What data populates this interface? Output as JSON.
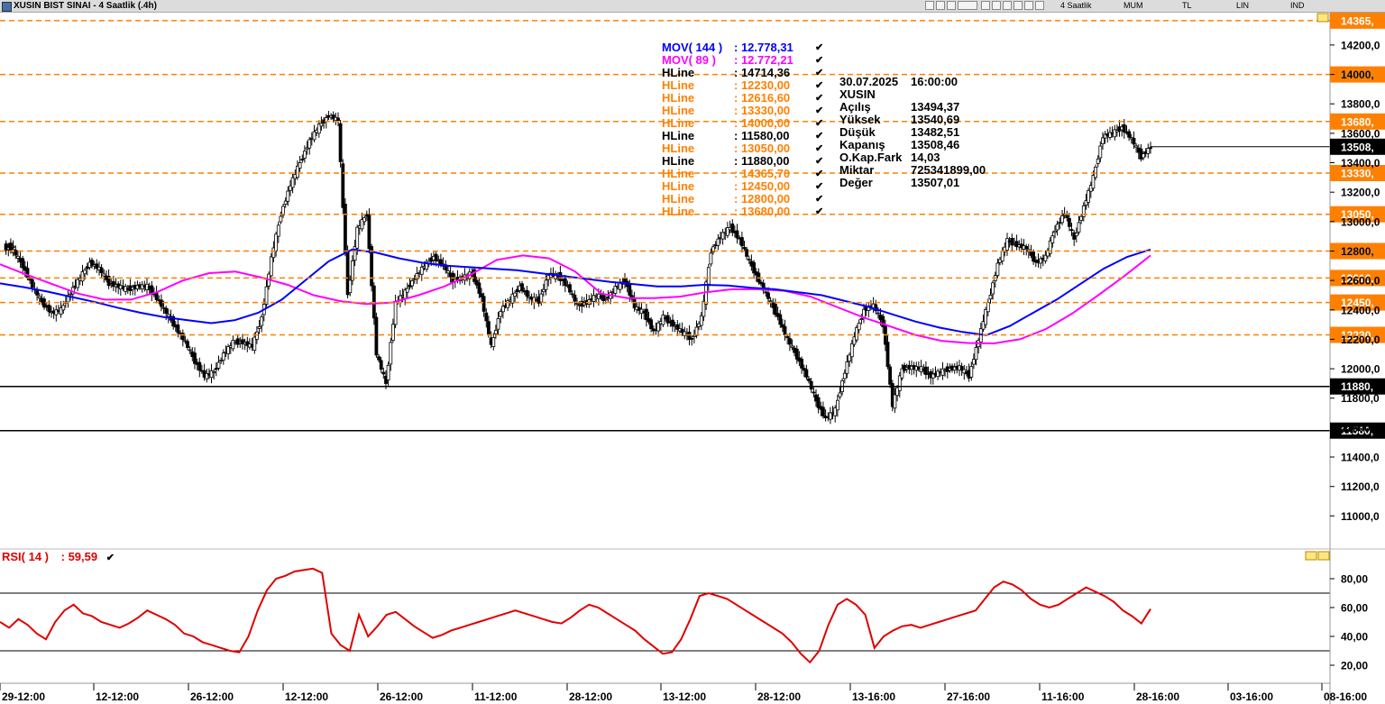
{
  "window": {
    "title": "XUSIN BIST SINAI - 4 Saatlik (.4h)",
    "toolbar": [
      "4 Saatlik",
      "MUM",
      "TL",
      "LIN",
      "IND"
    ]
  },
  "price_axis": {
    "ticks": [
      "14200,0",
      "14000,",
      "13800,0",
      "13600,0",
      "13400,0",
      "13200,0",
      "13000,0",
      "12800,",
      "12600,0",
      "12400,0",
      "12200,0",
      "12000,0",
      "11800,0",
      "11600,0",
      "11400,0",
      "11200,0",
      "11000,0"
    ]
  },
  "rsi_axis": {
    "ticks": [
      "80,00",
      "60,00",
      "40,00",
      "20,00"
    ]
  },
  "time_axis": {
    "labels": [
      "29-12:00",
      "12-12:00",
      "26-12:00",
      "12-12:00",
      "26-12:00",
      "11-12:00",
      "28-12:00",
      "13-12:00",
      "28-12:00",
      "13-16:00",
      "27-16:00",
      "11-16:00",
      "28-16:00",
      "03-16:00",
      "08-16:00"
    ]
  },
  "hlines": [
    {
      "value": 14365.7,
      "tag": "14365,",
      "color": "#ff8000",
      "dash": true
    },
    {
      "value": 14000.0,
      "tag": "14000,",
      "color": "#ff8000",
      "dash": true
    },
    {
      "value": 13680.0,
      "tag": "13680,",
      "color": "#ff8000",
      "dash": true
    },
    {
      "value": 13330.0,
      "tag": "13330,",
      "color": "#ff8000",
      "dash": true
    },
    {
      "value": 13050.0,
      "tag": "13050,",
      "color": "#ff8000",
      "dash": true
    },
    {
      "value": 12800.0,
      "tag": "12800,",
      "color": "#ff8000",
      "dash": true
    },
    {
      "value": 12616.6,
      "tag": "12616,",
      "color": "#ff8000",
      "dash": true
    },
    {
      "value": 12450.0,
      "tag": "12450,",
      "color": "#ff8000",
      "dash": true
    },
    {
      "value": 12230.0,
      "tag": "12230,",
      "color": "#ff8000",
      "dash": true
    },
    {
      "value": 11880.0,
      "tag": "11880,",
      "color": "#000000",
      "dash": false
    },
    {
      "value": 11580.0,
      "tag": "11580,",
      "color": "#000000",
      "dash": false
    }
  ],
  "last_price": {
    "value": 13508.46,
    "tag": "13508,"
  },
  "indicators": [
    {
      "name": "MOV( 144 )",
      "value": ": 12.778,31",
      "color": "#0000ff"
    },
    {
      "name": "MOV( 89 )",
      "value": ": 12.772,21",
      "color": "#ff00ff"
    },
    {
      "name": "HLine",
      "value": ": 14714,36",
      "color": "#000000"
    },
    {
      "name": "HLine",
      "value": ": 12230,00",
      "color": "#ff8000"
    },
    {
      "name": "HLine",
      "value": ": 12616,60",
      "color": "#ff8000"
    },
    {
      "name": "HLine",
      "value": ": 13330,00",
      "color": "#ff8000"
    },
    {
      "name": "HLine",
      "value": ": 14000,00",
      "color": "#ff8000"
    },
    {
      "name": "HLine",
      "value": ": 11580,00",
      "color": "#000000"
    },
    {
      "name": "HLine",
      "value": ": 13050,00",
      "color": "#ff8000"
    },
    {
      "name": "HLine",
      "value": ": 11880,00",
      "color": "#000000"
    },
    {
      "name": "HLine",
      "value": ": 14365,70",
      "color": "#ff8000"
    },
    {
      "name": "HLine",
      "value": ": 12450,00",
      "color": "#ff8000"
    },
    {
      "name": "HLine",
      "value": ": 12800,00",
      "color": "#ff8000"
    },
    {
      "name": "HLine",
      "value": ": 13680,00",
      "color": "#ff8000"
    }
  ],
  "data_box": {
    "date": "30.07.2025",
    "time": "16:00:00",
    "symbol": "XUSIN",
    "rows": [
      {
        "key": "Açılış",
        "value": "13494,37"
      },
      {
        "key": "Yüksek",
        "value": "13540,69"
      },
      {
        "key": "Düşük",
        "value": "13482,51"
      },
      {
        "key": "Kapanış",
        "value": "13508,46"
      },
      {
        "key": "O.Kap.Fark",
        "value": "14,03"
      },
      {
        "key": "Miktar",
        "value": "725341899,00"
      },
      {
        "key": "Değer",
        "value": "13507,01"
      }
    ]
  },
  "rsi": {
    "label": "RSI( 14 )",
    "value": ": 59,59",
    "color": "#e00000",
    "levels": [
      70,
      30
    ]
  },
  "chart_data": {
    "type": "line",
    "title": "XUSIN BIST SINAI - 4 Saatlik (.4h)",
    "ylim": [
      10800,
      14420
    ],
    "rsi_ylim": [
      10,
      90
    ],
    "x_count": 121,
    "close": [
      12830,
      12800,
      12700,
      12560,
      12450,
      12380,
      12400,
      12520,
      12620,
      12720,
      12680,
      12580,
      12560,
      12540,
      12560,
      12560,
      12480,
      12380,
      12280,
      12180,
      12050,
      11950,
      11980,
      12100,
      12180,
      12180,
      12150,
      12350,
      12750,
      13050,
      13250,
      13400,
      13550,
      13650,
      13720,
      13690,
      12500,
      12950,
      13050,
      12100,
      11900,
      12450,
      12520,
      12620,
      12700,
      12760,
      12700,
      12600,
      12620,
      12650,
      12480,
      12150,
      12400,
      12470,
      12560,
      12480,
      12460,
      12640,
      12630,
      12560,
      12430,
      12450,
      12500,
      12470,
      12550,
      12600,
      12420,
      12380,
      12250,
      12350,
      12300,
      12250,
      12200,
      12350,
      12800,
      12900,
      12960,
      12880,
      12730,
      12600,
      12480,
      12350,
      12200,
      12080,
      11950,
      11780,
      11660,
      11720,
      11980,
      12220,
      12400,
      12430,
      12300,
      11750,
      12000,
      12010,
      12000,
      11950,
      11980,
      12000,
      12010,
      11950,
      12200,
      12450,
      12710,
      12870,
      12840,
      12820,
      12720,
      12760,
      12950,
      13060,
      12880,
      13100,
      13300,
      13580,
      13600,
      13640,
      13560,
      13440,
      13508
    ],
    "ma144": [
      12580,
      12555,
      12525,
      12490,
      12455,
      12415,
      12380,
      12350,
      12330,
      12310,
      12330,
      12380,
      12470,
      12600,
      12730,
      12810,
      12790,
      12750,
      12720,
      12700,
      12690,
      12680,
      12670,
      12650,
      12630,
      12610,
      12590,
      12575,
      12560,
      12560,
      12570,
      12565,
      12550,
      12540,
      12520,
      12500,
      12460,
      12420,
      12370,
      12320,
      12280,
      12250,
      12228,
      12290,
      12380,
      12470,
      12575,
      12680,
      12760,
      12810
    ],
    "ma89": [
      12710,
      12640,
      12575,
      12510,
      12470,
      12470,
      12520,
      12600,
      12650,
      12660,
      12620,
      12570,
      12500,
      12460,
      12440,
      12450,
      12500,
      12560,
      12640,
      12740,
      12770,
      12750,
      12660,
      12510,
      12480,
      12480,
      12490,
      12520,
      12540,
      12540,
      12530,
      12490,
      12420,
      12350,
      12290,
      12230,
      12190,
      12175,
      12172,
      12200,
      12270,
      12375,
      12500,
      12630,
      12770
    ],
    "rsi": [
      50,
      46,
      52,
      48,
      42,
      38,
      50,
      58,
      62,
      56,
      54,
      50,
      48,
      46,
      49,
      53,
      58,
      55,
      52,
      48,
      42,
      40,
      36,
      34,
      32,
      30,
      29,
      40,
      58,
      72,
      80,
      82,
      85,
      86,
      87,
      84,
      42,
      34,
      30,
      55,
      40,
      47,
      55,
      57,
      52,
      47,
      43,
      39,
      41,
      44,
      46,
      48,
      50,
      52,
      54,
      56,
      58,
      56,
      54,
      52,
      50,
      49,
      53,
      58,
      62,
      60,
      56,
      52,
      48,
      44,
      38,
      33,
      28,
      29,
      38,
      52,
      68,
      70,
      68,
      66,
      62,
      58,
      54,
      50,
      46,
      42,
      36,
      28,
      22,
      30,
      48,
      62,
      66,
      62,
      55,
      32,
      40,
      44,
      47,
      48,
      46,
      48,
      50,
      52,
      54,
      56,
      58,
      66,
      74,
      78,
      76,
      72,
      66,
      62,
      60,
      62,
      66,
      70,
      74,
      71,
      68,
      64,
      58,
      54,
      49,
      59
    ]
  }
}
